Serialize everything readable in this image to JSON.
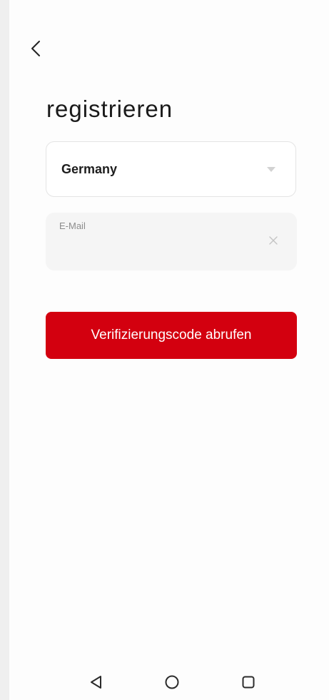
{
  "header": {
    "back_icon": "chevron-left-icon",
    "title": "registrieren"
  },
  "form": {
    "country": {
      "selected": "Germany",
      "icon": "caret-down-icon"
    },
    "email": {
      "label": "E-Mail",
      "value": "",
      "clear_icon": "close-icon"
    },
    "submit_label": "Verifizierungscode abrufen"
  },
  "navigation": {
    "back_icon": "triangle-back-icon",
    "home_icon": "circle-home-icon",
    "recents_icon": "square-recents-icon"
  },
  "colors": {
    "accent": "#d3000f",
    "background": "#fdfdfd",
    "field_background": "#f5f5f5",
    "border": "#e4e4e4"
  }
}
